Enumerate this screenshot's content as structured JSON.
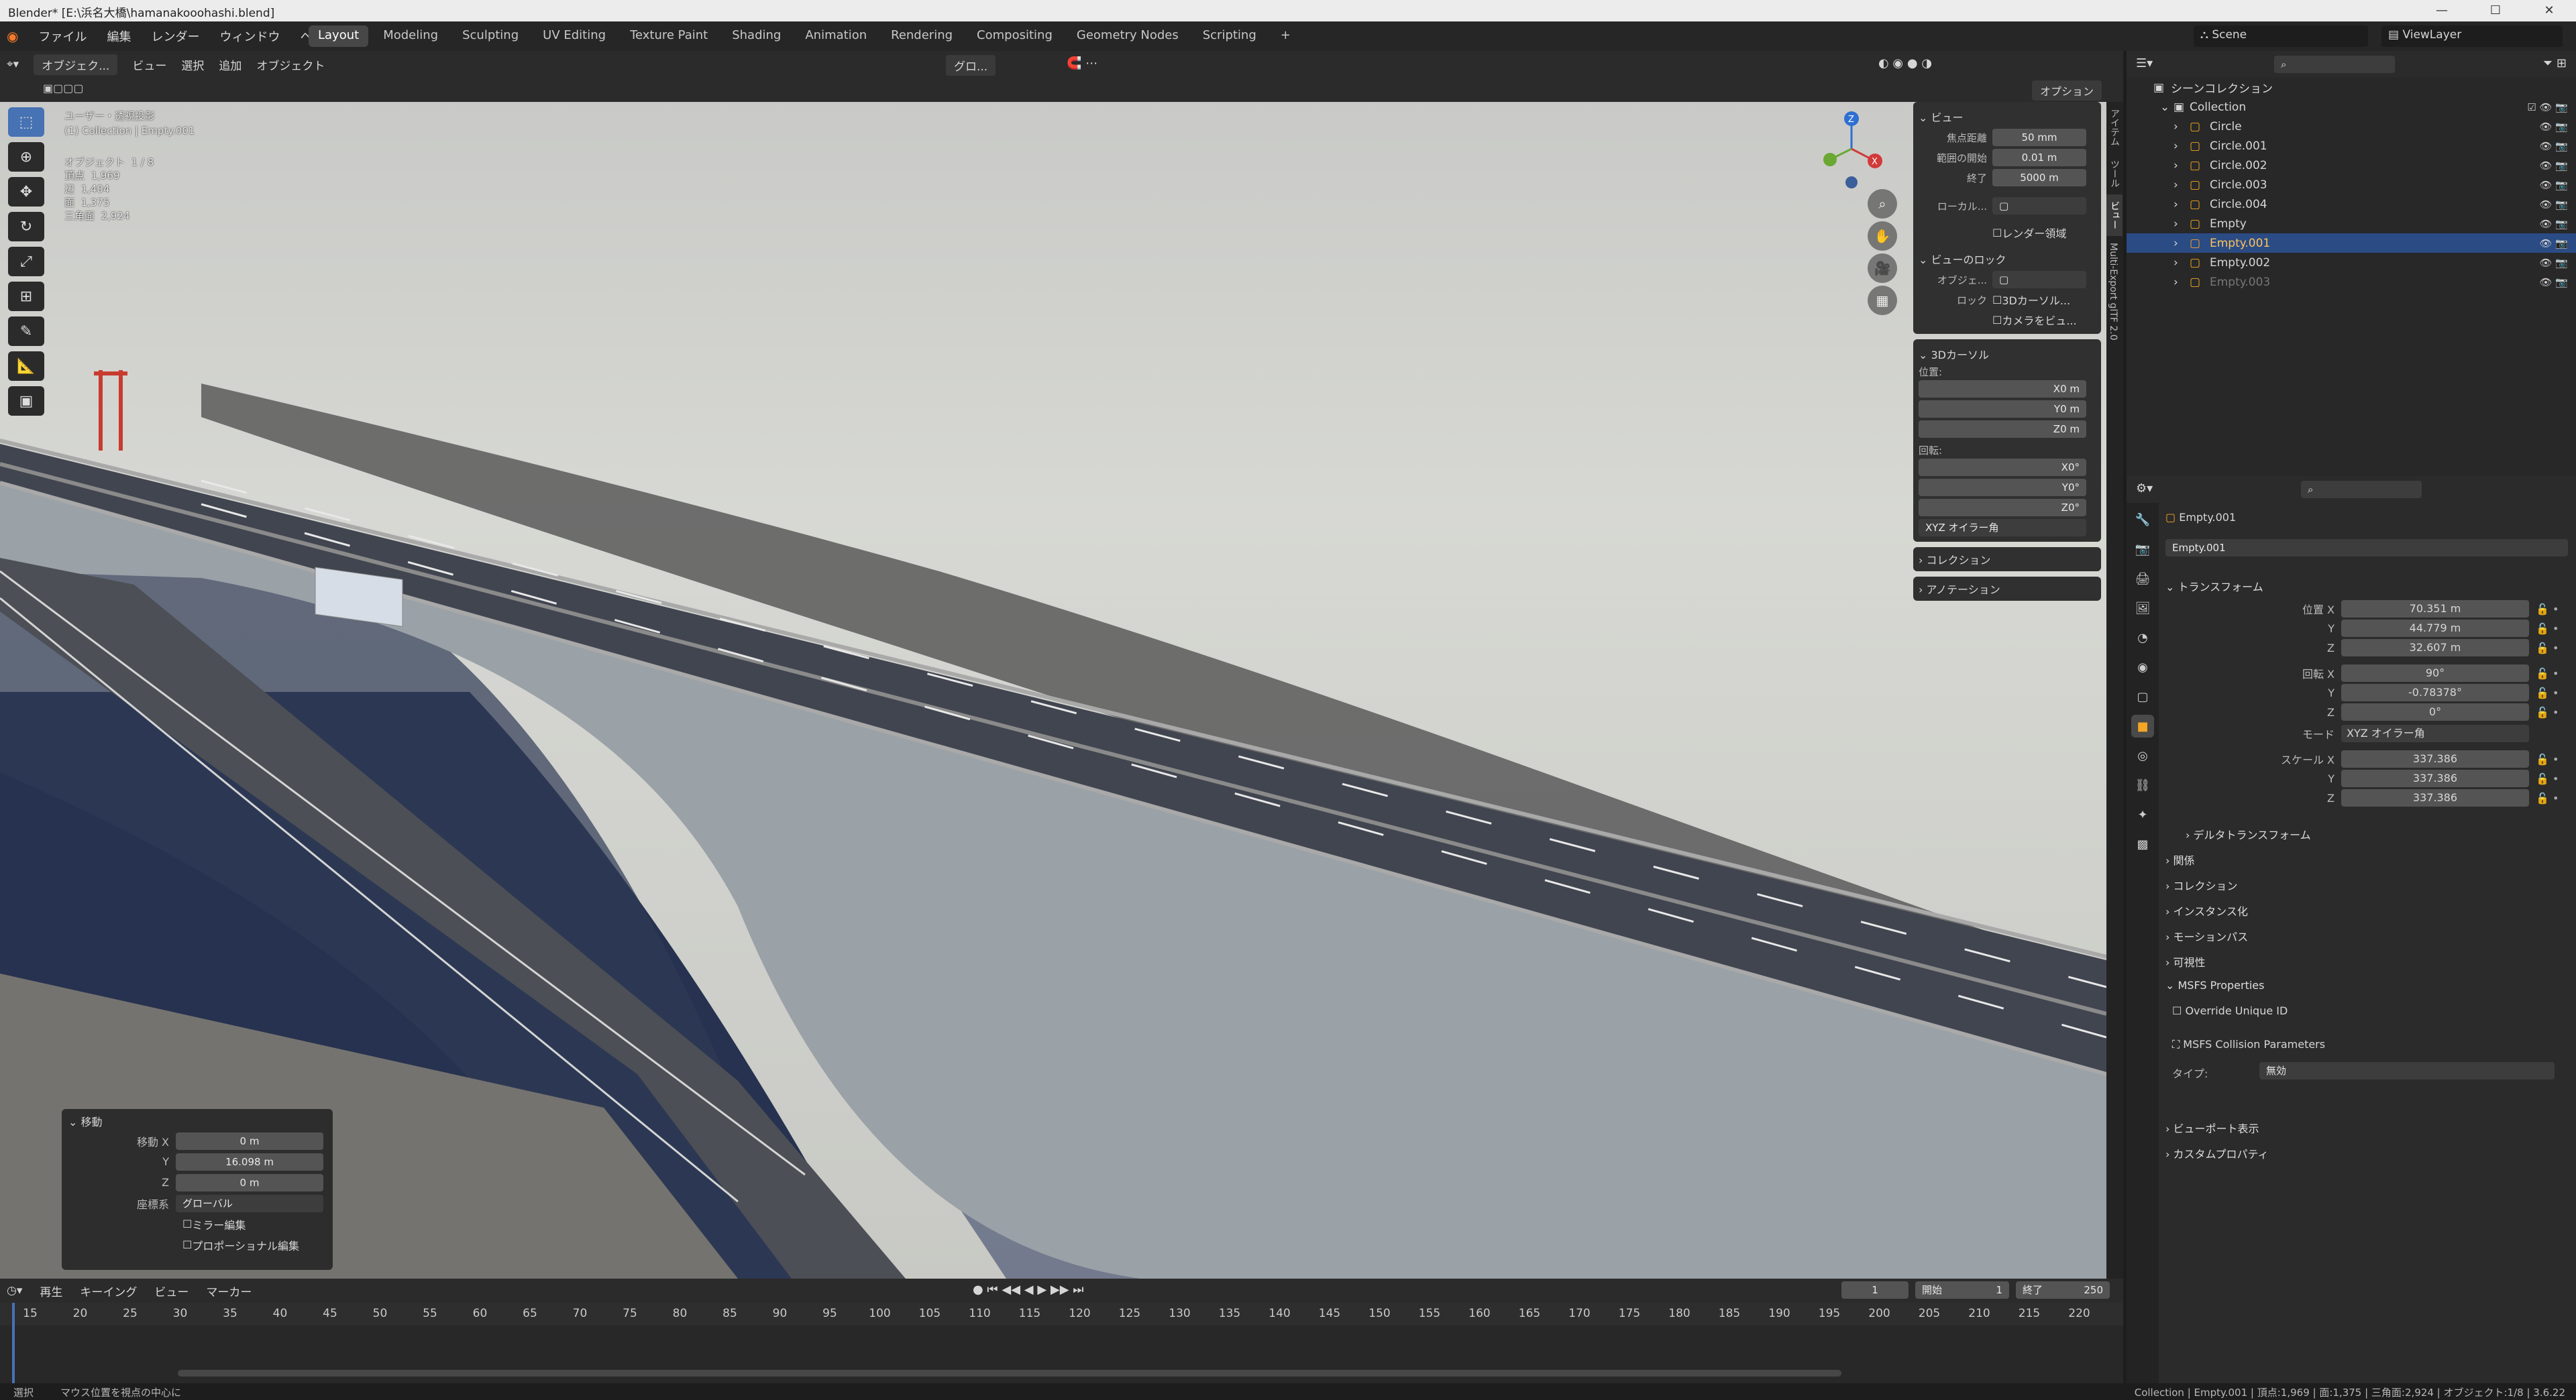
{
  "window": {
    "title": "Blender* [E:\\浜名大橋\\hamanakooohashi.blend]"
  },
  "menu": [
    "ファイル",
    "編集",
    "レンダー",
    "ウィンドウ",
    "ヘルプ"
  ],
  "tabs": [
    "Layout",
    "Modeling",
    "Sculpting",
    "UV Editing",
    "Texture Paint",
    "Shading",
    "Animation",
    "Rendering",
    "Compositing",
    "Geometry Nodes",
    "Scripting"
  ],
  "scene": "Scene",
  "view_layer": "ViewLayer",
  "viewport_header": {
    "mode": "オブジェク...",
    "menus": [
      "ビュー",
      "選択",
      "追加",
      "オブジェクト"
    ],
    "transform_orientation": "グロ...",
    "options": "オプション"
  },
  "viewport_overlay": {
    "view_name": "ユーザー・透視投影",
    "collection_info": "(1) Collection | Empty.001",
    "stats": [
      {
        "label": "オブジェクト",
        "value": "1 / 8"
      },
      {
        "label": "頂点",
        "value": "1,969"
      },
      {
        "label": "辺",
        "value": "1,404"
      },
      {
        "label": "面",
        "value": "1,375"
      },
      {
        "label": "三角面",
        "value": "2,924"
      }
    ]
  },
  "npanel": {
    "view": {
      "title": "ビュー",
      "focal_label": "焦点距離",
      "focal_value": "50 mm",
      "clip_start_label": "範囲の開始",
      "clip_start_value": "0.01 m",
      "clip_end_label": "終了",
      "clip_end_value": "5000 m",
      "local_label": "ローカル...",
      "render_region": "レンダー領域",
      "lock_title": "ビューのロック",
      "lock_object_label": "オブジェ...",
      "lock_label": "ロック",
      "lock_cursor": "3Dカーソル...",
      "lock_camera": "カメラをビュ..."
    },
    "cursor": {
      "title": "3Dカーソル",
      "location_label": "位置:",
      "x": "0 m",
      "y": "0 m",
      "z": "0 m",
      "rotation_label": "回転:",
      "rx": "0°",
      "ry": "0°",
      "rz": "0°",
      "mode": "XYZ オイラー角"
    },
    "collection": "コレクション",
    "annotation": "アノテーション",
    "side_tabs": [
      "アイテム",
      "ツール",
      "ビュー",
      "Multi-Export glTF 2.0"
    ]
  },
  "operator_panel": {
    "title": "移動",
    "x_label": "移動 X",
    "x": "0 m",
    "y_label": "Y",
    "y": "16.098 m",
    "z_label": "Z",
    "z": "0 m",
    "orient_label": "座標系",
    "orient": "グローバル",
    "mirror": "ミラー編集",
    "proportional": "プロポーショナル編集"
  },
  "timeline": {
    "menus": [
      "再生",
      "キーイング",
      "ビュー",
      "マーカー"
    ],
    "current_frame": "1",
    "start_label": "開始",
    "start": "1",
    "end_label": "終了",
    "end": "250",
    "ticks": [
      "15",
      "20",
      "25",
      "30",
      "35",
      "40",
      "45",
      "50",
      "55",
      "60",
      "65",
      "70",
      "75",
      "80",
      "85",
      "90",
      "95",
      "100",
      "105",
      "110",
      "115",
      "120",
      "125",
      "130",
      "135",
      "140",
      "145",
      "150",
      "155",
      "160",
      "165",
      "170",
      "175",
      "180",
      "185",
      "190",
      "195",
      "200",
      "205",
      "210",
      "215",
      "220"
    ]
  },
  "statusbar": {
    "left1": "選択",
    "left2": "マウス位置を視点の中心に",
    "right": "Collection | Empty.001 | 頂点:1,969 | 面:1,375 | 三角面:2,924 | オブジェクト:1/8 | 3.6.22"
  },
  "outliner": {
    "root": "シーンコレクション",
    "collection": "Collection",
    "items": [
      {
        "name": "Circle",
        "selected": false,
        "dim": false
      },
      {
        "name": "Circle.001",
        "selected": false,
        "dim": false
      },
      {
        "name": "Circle.002",
        "selected": false,
        "dim": false
      },
      {
        "name": "Circle.003",
        "selected": false,
        "dim": false
      },
      {
        "name": "Circle.004",
        "selected": false,
        "dim": false
      },
      {
        "name": "Empty",
        "selected": false,
        "dim": false
      },
      {
        "name": "Empty.001",
        "selected": true,
        "dim": false
      },
      {
        "name": "Empty.002",
        "selected": false,
        "dim": false
      },
      {
        "name": "Empty.003",
        "selected": false,
        "dim": true
      }
    ]
  },
  "properties": {
    "object_name": "Empty.001",
    "object_field": "Empty.001",
    "transform_title": "トランスフォーム",
    "loc_label": "位置 X",
    "loc_x": "70.351 m",
    "loc_y": "44.779 m",
    "loc_z": "32.607 m",
    "rot_label": "回転 X",
    "rot_x": "90°",
    "rot_y": "-0.78378°",
    "rot_z": "0°",
    "mode_label": "モード",
    "mode": "XYZ オイラー角",
    "scale_label": "スケール X",
    "scale_x": "337.386",
    "scale_y": "337.386",
    "scale_z": "337.386",
    "y_label": "Y",
    "z_label": "Z",
    "delta": "デルタトランスフォーム",
    "sections": [
      "関係",
      "コレクション",
      "インスタンス化",
      "モーションパス",
      "可視性"
    ],
    "msfs_title": "MSFS Properties",
    "override_uid": "Override Unique ID",
    "collision": "MSFS Collision Parameters",
    "type_label": "タイプ:",
    "type_value": "無効",
    "viewport_display": "ビューポート表示",
    "custom_props": "カスタムプロパティ"
  },
  "colors": {
    "accent": "#4772b3",
    "selected_row": "#2b4b84",
    "object_orange": "#f5a623"
  }
}
